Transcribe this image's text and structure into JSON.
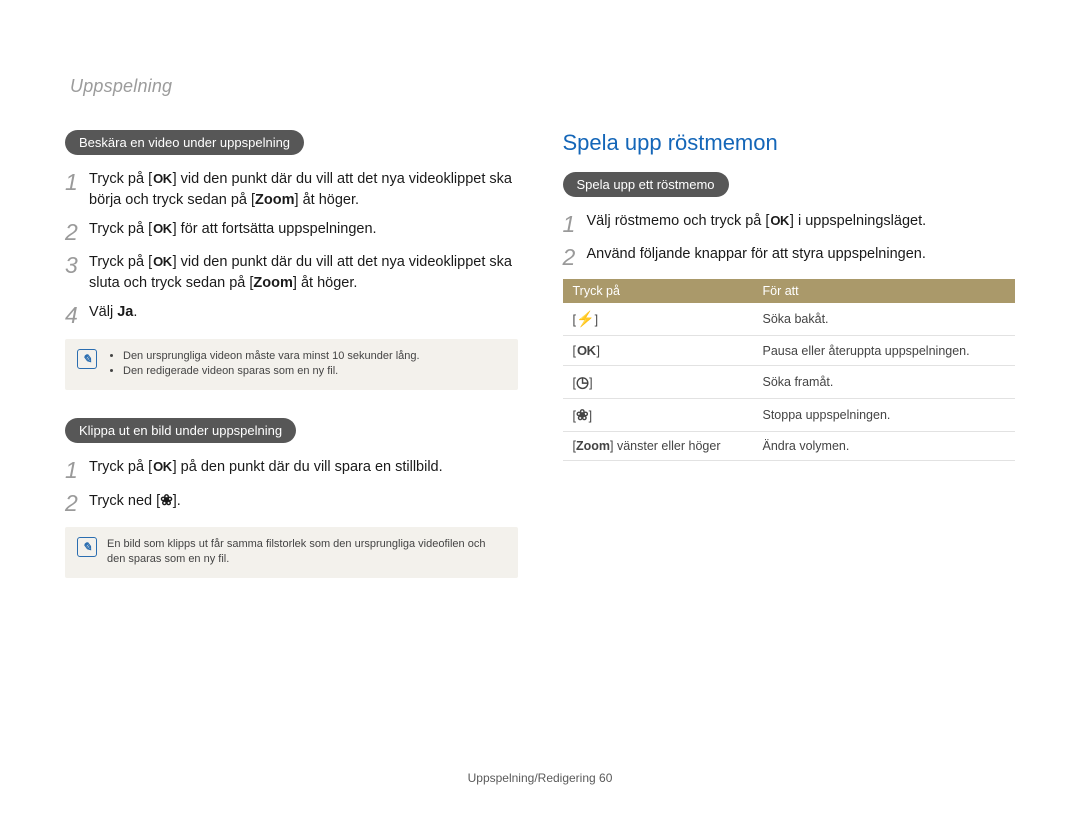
{
  "running_head": "Uppspelning",
  "left": {
    "pill1": "Beskära en video under uppspelning",
    "step1_a": "Tryck på [",
    "step1_b": "] vid den punkt där du vill att det nya videoklippet ska börja och tryck sedan på [",
    "step1_zoom": "Zoom",
    "step1_c": "] åt höger.",
    "step2_a": "Tryck på [",
    "step2_b": "] för att fortsätta uppspelningen.",
    "step3_a": "Tryck på [",
    "step3_b": "] vid den punkt där du vill att det nya videoklippet ska sluta och tryck sedan på [",
    "step3_zoom": "Zoom",
    "step3_c": "] åt höger.",
    "step4_a": "Välj ",
    "step4_b": "Ja",
    "step4_c": ".",
    "note1_li1": "Den ursprungliga videon måste vara minst 10 sekunder lång.",
    "note1_li2": "Den redigerade videon sparas som en ny fil.",
    "pill2": "Klippa ut en bild under uppspelning",
    "s2_step1_a": "Tryck på [",
    "s2_step1_b": "] på den punkt där du vill spara en stillbild.",
    "s2_step2_a": "Tryck ned [",
    "s2_step2_b": "].",
    "note2": "En bild som klipps ut får samma filstorlek som den ursprungliga videofilen och den sparas som en ny fil."
  },
  "right": {
    "heading": "Spela upp röstmemon",
    "pill": "Spela upp ett röstmemo",
    "step1_a": "Välj röstmemo och tryck på [",
    "step1_b": "] i uppspelningsläget.",
    "step2": "Använd följande knappar för att styra uppspelningen.",
    "th1": "Tryck på",
    "th2": "För att",
    "rows": [
      {
        "left_open": "[",
        "glyph": "⚡",
        "left_close": "]",
        "right": "Söka bakåt."
      },
      {
        "left_open": "[",
        "glyph": "OK",
        "left_close": "]",
        "right": "Pausa eller återuppta uppspelningen."
      },
      {
        "left_open": "[",
        "glyph": "◷",
        "left_close": "]",
        "right": "Söka framåt."
      },
      {
        "left_open": "[",
        "glyph": "❀",
        "left_close": "]",
        "right": "Stoppa uppspelningen."
      },
      {
        "left_open": "[",
        "label": "Zoom",
        "tail": "] vänster eller höger",
        "right": "Ändra volymen."
      }
    ]
  },
  "footer_a": "Uppspelning/Redigering  ",
  "footer_b": "60",
  "ok_label": "OK",
  "macro_glyph": "❀"
}
